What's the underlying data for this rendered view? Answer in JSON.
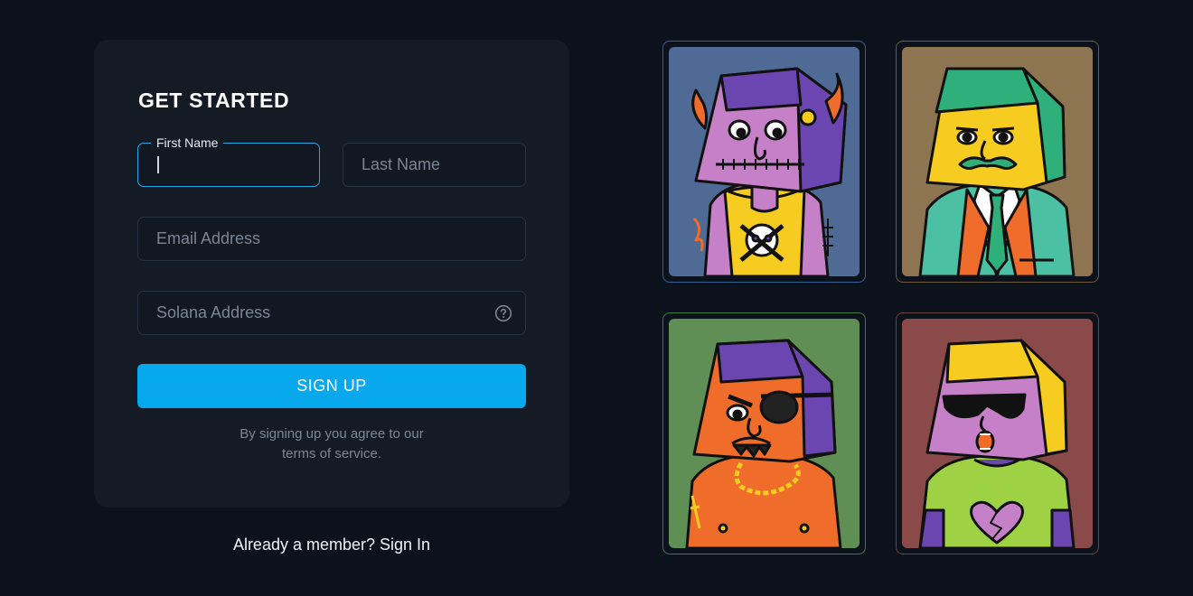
{
  "form": {
    "title": "GET STARTED",
    "first_name": {
      "label": "First Name",
      "value": ""
    },
    "last_name": {
      "placeholder": "Last Name"
    },
    "email": {
      "placeholder": "Email Address"
    },
    "solana": {
      "placeholder": "Solana Address",
      "help_icon": "question-circle-icon"
    },
    "submit_label": "SIGN UP",
    "terms_line1": "By signing up you agree to our",
    "terms_line2": "terms of service."
  },
  "footer": {
    "signin_text": "Already a member? Sign In"
  },
  "gallery": [
    {
      "name": "devil-character",
      "bg": "#4f6a95",
      "border": "#3b5f8f"
    },
    {
      "name": "businessman-character",
      "bg": "#8d7552",
      "border": "#6d5b3e"
    },
    {
      "name": "pirate-character",
      "bg": "#5f8f55",
      "border": "#3f7a47"
    },
    {
      "name": "sunglasses-character",
      "bg": "#8b4a4a",
      "border": "#6d4141"
    }
  ],
  "colors": {
    "accent": "#08a9ec",
    "background": "#0c121c",
    "card": "#151b24"
  }
}
